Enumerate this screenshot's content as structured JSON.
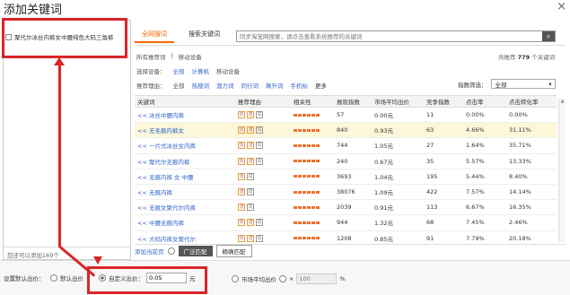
{
  "dialog": {
    "title": "添加关键词",
    "close_label": "×"
  },
  "left": {
    "selected_keyword": "聚代尔冰丝内裤女中腰纯色大码三角裤",
    "footer": "您还可以添加169个"
  },
  "tabs": [
    {
      "label": "全网搜词"
    },
    {
      "label": "搜索关键词"
    }
  ],
  "search": {
    "placeholder": "同步淘宝网搜索，请点击查看系统推荐的关键词",
    "icon": "search-icon"
  },
  "breadcrumb": {
    "root": "所有推荐词",
    "sep": "|",
    "current": "移动设备"
  },
  "total": {
    "prefix": "共推荐",
    "count": "779",
    "suffix": "个关键词"
  },
  "filters": {
    "device_label": "选择设备：",
    "device_opts": [
      "全部",
      "计算机",
      "移动设备"
    ],
    "reason_label": "推荐理由：",
    "reason_opts": [
      "全部",
      "热搜词",
      "潜力词",
      "同行词",
      "飙升词",
      "手机标"
    ],
    "more": "更多",
    "index_label": "指数筛选：",
    "index_value": "全部"
  },
  "table": {
    "headers": [
      "关键词",
      "推荐理由",
      "相关性",
      "展现指数",
      "市场平均出价",
      "竞争指数",
      "点击率",
      "点击转化率"
    ],
    "rows": [
      {
        "kw": "<< 冰丝中腰内裤",
        "tags": [
          "热",
          "潜",
          "同"
        ],
        "shows": "57",
        "price": "0.00元",
        "comp": "11",
        "ctr": "0.00%",
        "cvr": "0.00%"
      },
      {
        "kw": "<< 无毛痕内裤女",
        "tags": [
          "热",
          "潜",
          "同"
        ],
        "shows": "840",
        "price": "0.93元",
        "comp": "63",
        "ctr": "4.66%",
        "cvr": "31.11%"
      },
      {
        "kw": "<< 一片式冰丝女内裤",
        "tags": [
          "热",
          "潜",
          "同"
        ],
        "shows": "744",
        "price": "1.05元",
        "comp": "27",
        "ctr": "1.64%",
        "cvr": "35.71%"
      },
      {
        "kw": "<< 聚代尔无痕内裤",
        "tags": [
          "热",
          "潜",
          "同"
        ],
        "shows": "240",
        "price": "0.67元",
        "comp": "35",
        "ctr": "5.57%",
        "cvr": "13.33%"
      },
      {
        "kw": "<< 无痕内裤 女 中腰",
        "tags": [
          "潜",
          "同"
        ],
        "shows": "3693",
        "price": "1.04元",
        "comp": "195",
        "ctr": "5.44%",
        "cvr": "8.40%"
      },
      {
        "kw": "<< 无痕内裤",
        "tags": [
          "潜",
          "同"
        ],
        "shows": "38076",
        "price": "1.09元",
        "comp": "422",
        "ctr": "7.57%",
        "cvr": "14.14%"
      },
      {
        "kw": "<< 无痕女聚代尔内裤",
        "tags": [
          "潜",
          "同"
        ],
        "shows": "2039",
        "price": "0.91元",
        "comp": "113",
        "ctr": "6.67%",
        "cvr": "16.35%"
      },
      {
        "kw": "<< 中腰无痕内裤",
        "tags": [
          "热",
          "潜",
          "同"
        ],
        "shows": "944",
        "price": "1.32元",
        "comp": "68",
        "ctr": "7.45%",
        "cvr": "2.46%"
      },
      {
        "kw": "<< 大码内裤女聚代尔",
        "tags": [
          "热",
          "潜",
          "同"
        ],
        "shows": "1208",
        "price": "0.85元",
        "comp": "91",
        "ctr": "7.79%",
        "cvr": "20.18%"
      }
    ]
  },
  "bottom_strip": {
    "add_page": "添加当前页",
    "broad_match": "广泛匹配",
    "exact_match": "精确匹配"
  },
  "bid": {
    "label": "设置默认出价：",
    "default_bid": "默认出价",
    "custom_bid": "自定义出价：",
    "custom_value": "0.05",
    "unit": "元",
    "market_avg": "市场平均出价",
    "x": "×",
    "pct_placeholder": "100",
    "pct": "%"
  }
}
